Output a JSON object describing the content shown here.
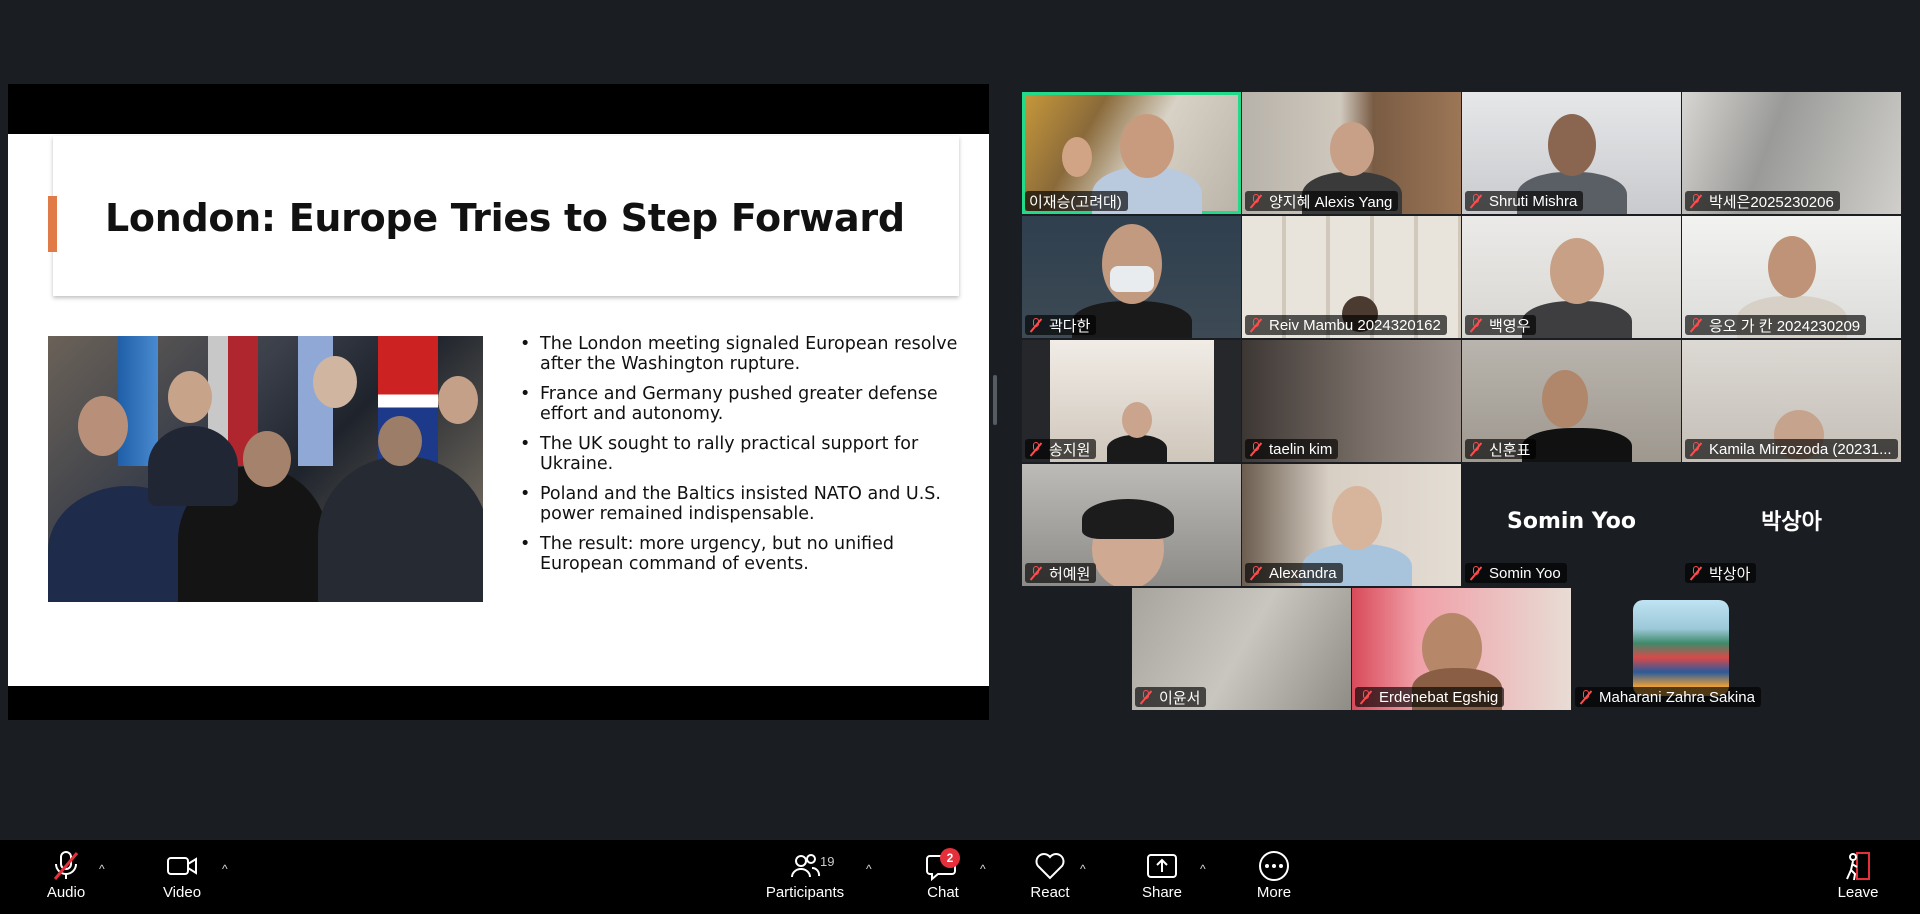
{
  "slide": {
    "title": "London: Europe Tries to Step Forward",
    "bullets": [
      "The London meeting signaled European resolve after the Washington rupture.",
      "France and Germany pushed greater defense effort and autonomy.",
      "The UK sought to rally practical support for Ukraine.",
      "Poland and the Baltics insisted NATO and U.S. power remained indispensable.",
      "The result: more urgency, but no unified European command of events."
    ],
    "accent_color": "#e07b47"
  },
  "participants": [
    {
      "name": "이재승(고려대)",
      "muted": false,
      "active": true
    },
    {
      "name": "양지혜 Alexis Yang",
      "muted": true
    },
    {
      "name": "Shruti Mishra",
      "muted": true
    },
    {
      "name": "박세은2025230206",
      "muted": true
    },
    {
      "name": "곽다한",
      "muted": true
    },
    {
      "name": "Reiv Mambu 2024320162",
      "muted": true
    },
    {
      "name": "백영우",
      "muted": true
    },
    {
      "name": "응오 가 칸 2024230209",
      "muted": true
    },
    {
      "name": "송지원",
      "muted": true
    },
    {
      "name": "taelin kim",
      "muted": true
    },
    {
      "name": "신훈표",
      "muted": true
    },
    {
      "name": "Kamila Mirzozoda (20231...",
      "muted": true
    },
    {
      "name": "허예원",
      "muted": true
    },
    {
      "name": "Alexandra",
      "muted": true
    },
    {
      "name": "Somin Yoo",
      "muted": true,
      "display_name": "Somin Yoo"
    },
    {
      "name": "박상아",
      "muted": true,
      "display_name": "박상아"
    },
    {
      "name": "이윤서",
      "muted": true
    },
    {
      "name": "Erdenebat Egshig",
      "muted": true
    },
    {
      "name": "Maharani Zahra Sakina",
      "muted": true
    }
  ],
  "toolbar": {
    "audio": "Audio",
    "video": "Video",
    "participants": "Participants",
    "participants_count": "19",
    "chat": "Chat",
    "chat_badge": "2",
    "react": "React",
    "share": "Share",
    "more": "More",
    "leave": "Leave",
    "active_speaker_color": "#23d98a",
    "alert_color": "#e5303b"
  }
}
